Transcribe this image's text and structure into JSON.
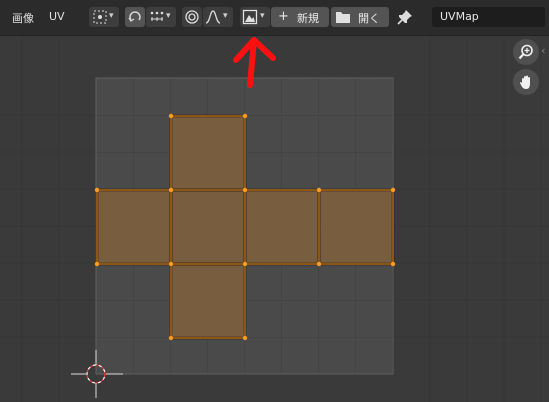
{
  "header": {
    "menu_image": "画像",
    "menu_uv": "UV",
    "new_label": "新規",
    "open_label": "開く",
    "uv_map_name": "UVMap",
    "icons": {
      "pivot": "pivot-point-icon",
      "sync": "uv-sync-selection-icon",
      "select_mode": "uv-select-mode-icon",
      "proportional": "proportional-editing-icon",
      "falloff": "proportional-falloff-icon",
      "image_browse": "image-browse-icon",
      "plus": "plus-icon",
      "folder": "folder-icon",
      "pin": "pin-icon"
    }
  },
  "viewport": {
    "icons": {
      "zoom": "zoom-icon",
      "pan": "pan-hand-icon",
      "cursor": "2d-cursor-icon"
    },
    "annotation": "red-arrow-annotation"
  },
  "colors": {
    "header_bg": "#2b2b2b",
    "viewport_bg": "#3a3a3a",
    "uv_face_fill": "#7d5e3e",
    "uv_edge": "#ff9b21",
    "annotation_red": "#ff1010"
  }
}
